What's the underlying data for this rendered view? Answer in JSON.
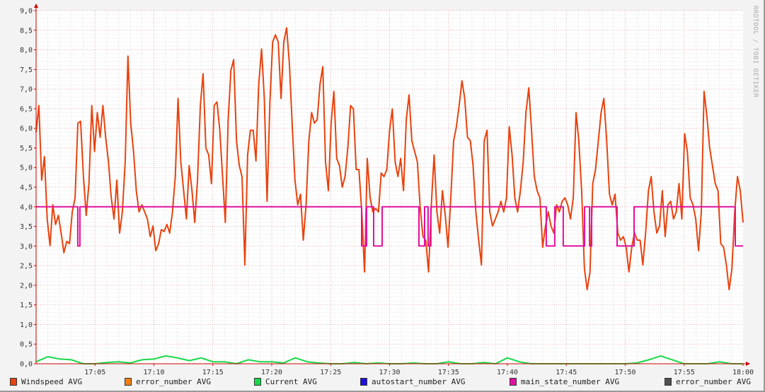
{
  "chart_data": {
    "type": "line",
    "title": "",
    "xlabel": "",
    "ylabel": "",
    "x_range": [
      "17:00",
      "18:00"
    ],
    "x_range_min": [
      0,
      60
    ],
    "ylim": [
      0,
      9
    ],
    "grid": true,
    "y_ticks": [
      "0,0",
      "0,5",
      "1,0",
      "1,5",
      "2,0",
      "2,5",
      "3,0",
      "3,5",
      "4,0",
      "4,5",
      "5,0",
      "5,5",
      "6,0",
      "6,5",
      "7,0",
      "7,5",
      "8,0",
      "8,5",
      "9,0"
    ],
    "x_ticks": [
      "17:05",
      "17:10",
      "17:15",
      "17:20",
      "17:25",
      "17:30",
      "17:35",
      "17:40",
      "17:45",
      "17:50",
      "17:55",
      "18:00"
    ],
    "legend_position": "bottom",
    "series": [
      {
        "name": "Windspeed AVG",
        "color": "#e8430e",
        "sampling": "uniform over x_range_min",
        "values": [
          5.9,
          6.58,
          4.68,
          5.28,
          3.69,
          3.01,
          4.05,
          3.55,
          3.78,
          3.33,
          2.83,
          3.12,
          3.06,
          3.87,
          4.23,
          6.13,
          6.18,
          4.77,
          3.78,
          4.59,
          6.58,
          5.41,
          6.4,
          5.77,
          6.58,
          5.77,
          5.14,
          4.23,
          3.69,
          4.68,
          3.33,
          3.87,
          5.14,
          7.84,
          6.13,
          5.41,
          4.41,
          3.87,
          4.05,
          3.87,
          3.69,
          3.24,
          3.51,
          2.88,
          3.06,
          3.42,
          3.37,
          3.55,
          3.33,
          3.87,
          4.77,
          6.76,
          5.14,
          4.41,
          3.69,
          5.05,
          4.41,
          3.6,
          4.68,
          6.58,
          7.39,
          5.5,
          5.32,
          4.59,
          6.58,
          6.67,
          5.95,
          4.77,
          3.6,
          6.22,
          7.48,
          7.75,
          5.68,
          5.05,
          4.77,
          2.52,
          5.32,
          5.95,
          5.95,
          5.17,
          7.12,
          8.02,
          6.76,
          4.14,
          6.67,
          8.2,
          8.38,
          8.2,
          6.76,
          8.2,
          8.56,
          7.66,
          6.13,
          4.68,
          4.05,
          4.32,
          3.15,
          4.05,
          5.68,
          6.4,
          6.13,
          6.22,
          7.12,
          7.57,
          5.14,
          4.41,
          6.13,
          6.94,
          5.23,
          5.05,
          4.5,
          4.77,
          5.5,
          6.58,
          6.49,
          4.95,
          4.95,
          3.87,
          2.34,
          5.23,
          4.23,
          3.87,
          3.96,
          3.87,
          4.86,
          4.77,
          4.95,
          5.95,
          6.49,
          5.14,
          4.77,
          5.23,
          4.41,
          6.22,
          6.85,
          5.68,
          5.41,
          5.14,
          3.96,
          3.24,
          3.15,
          2.34,
          4.05,
          5.32,
          3.87,
          3.33,
          4.41,
          3.78,
          2.97,
          4.23,
          5.68,
          6.04,
          6.58,
          7.21,
          6.76,
          5.77,
          5.68,
          5.05,
          3.87,
          3.15,
          2.52,
          5.68,
          5.95,
          3.87,
          3.51,
          3.69,
          3.87,
          4.14,
          3.87,
          4.23,
          6.04,
          5.32,
          4.23,
          3.87,
          4.41,
          5.14,
          6.4,
          7.03,
          5.95,
          4.77,
          4.41,
          4.23,
          2.97,
          3.51,
          3.87,
          3.51,
          3.33,
          4.05,
          3.87,
          4.14,
          4.23,
          4.05,
          3.69,
          4.23,
          6.4,
          5.68,
          4.41,
          2.43,
          1.89,
          2.34,
          4.59,
          4.95,
          5.68,
          6.4,
          6.76,
          5.68,
          4.32,
          4.05,
          4.32,
          3.33,
          3.15,
          3.24,
          2.97,
          2.34,
          2.97,
          3.33,
          3.15,
          3.15,
          2.52,
          3.33,
          4.41,
          4.77,
          3.87,
          3.33,
          3.51,
          4.41,
          3.24,
          4.05,
          4.14,
          3.69,
          3.87,
          4.59,
          3.69,
          5.86,
          5.41,
          4.23,
          4.05,
          3.69,
          2.88,
          3.87,
          6.94,
          6.31,
          5.5,
          5.05,
          4.59,
          4.41,
          3.06,
          2.97,
          2.52,
          1.89,
          2.43,
          3.87,
          4.77,
          4.41,
          3.6
        ]
      },
      {
        "name": "error_number AVG",
        "color": "#f07f10",
        "values": []
      },
      {
        "name": "Current AVG",
        "color": "#18d848",
        "sampling": "per minute",
        "values": [
          0.05,
          0.18,
          0.12,
          0.1,
          0,
          0,
          0.03,
          0.05,
          0.02,
          0.1,
          0.12,
          0.2,
          0.15,
          0.08,
          0.15,
          0.05,
          0.05,
          0,
          0.1,
          0.05,
          0.05,
          0.02,
          0.15,
          0.05,
          0.02,
          0,
          0,
          0.03,
          0,
          0.02,
          0,
          0,
          0.02,
          0,
          0,
          0.05,
          0,
          0,
          0.03,
          0,
          0.15,
          0.05,
          0,
          0,
          0,
          0,
          0,
          0,
          0,
          0,
          0,
          0.02,
          0.1,
          0.2,
          0.1,
          0,
          0,
          0,
          0.05,
          0,
          0
        ]
      },
      {
        "name": "autostart_number AVG",
        "color": "#2010e0",
        "values": []
      },
      {
        "name": "main_state_number AVG",
        "color": "#e010a0",
        "steps": [
          [
            0,
            4
          ],
          [
            3.54,
            3
          ],
          [
            3.72,
            4
          ],
          [
            27.63,
            3
          ],
          [
            28.05,
            4
          ],
          [
            28.65,
            3
          ],
          [
            29.37,
            4
          ],
          [
            32.49,
            3
          ],
          [
            32.97,
            4
          ],
          [
            33.27,
            3
          ],
          [
            33.51,
            4
          ],
          [
            43.3,
            3
          ],
          [
            44.02,
            4
          ],
          [
            44.74,
            3
          ],
          [
            46.55,
            4
          ],
          [
            46.97,
            3
          ],
          [
            47.15,
            4
          ],
          [
            49.31,
            3
          ],
          [
            50.75,
            4
          ],
          [
            59.34,
            3
          ],
          [
            60,
            3
          ]
        ]
      },
      {
        "name": "error_number AVG",
        "color": "#505050",
        "values": []
      }
    ],
    "watermark": "RRDTOOL / TOBI OETIKER"
  }
}
